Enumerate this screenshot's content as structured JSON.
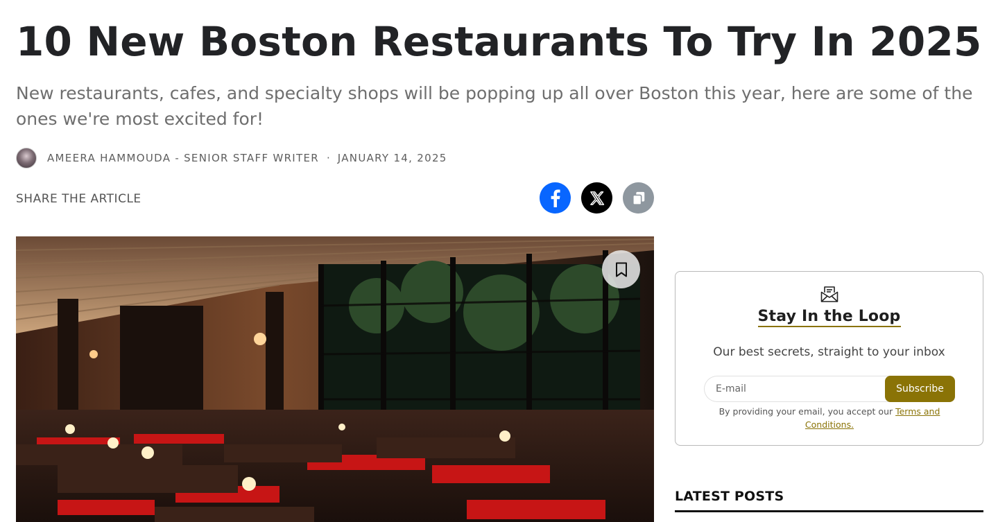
{
  "article": {
    "title": "10 New Boston Restaurants To Try In 2025",
    "subtitle": "New restaurants, cafes, and specialty shops will be popping up all over Boston this year, here are some of the ones we're most excited for!",
    "author": "AMEERA HAMMOUDA - SENIOR STAFF WRITER",
    "separator": "·",
    "date": "JANUARY 14, 2025"
  },
  "share": {
    "label": "SHARE THE ARTICLE",
    "buttons": [
      {
        "name": "facebook",
        "icon": "facebook-icon",
        "color": "#0866ff"
      },
      {
        "name": "x",
        "icon": "x-icon",
        "color": "#000000"
      },
      {
        "name": "copy-link",
        "icon": "copy-icon",
        "color": "#8e979f"
      }
    ]
  },
  "hero_image": {
    "icon": "bookmark-icon"
  },
  "newsletter": {
    "icon": "envelope-icon",
    "title": "Stay In the Loop",
    "subtitle": "Our best secrets, straight to your inbox",
    "email_placeholder": "E-mail",
    "email_value": "",
    "submit_label": "Subscribe",
    "terms_prefix": "By providing your email, you accept our ",
    "terms_link": "Terms and Conditions.",
    "accent_color": "#8a7306"
  },
  "sidebar": {
    "latest_heading": "LATEST POSTS"
  }
}
